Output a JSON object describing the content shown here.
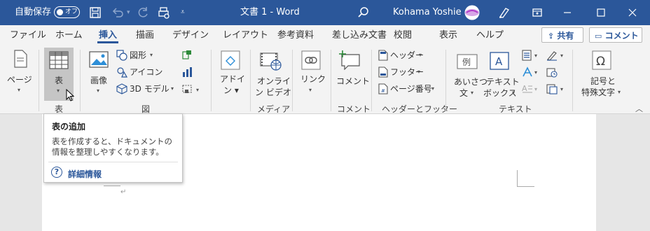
{
  "titlebar": {
    "autosave_label": "自動保存",
    "autosave_state": "オフ",
    "doc_title": "文書 1  -  Word",
    "user_name": "Kohama Yoshie"
  },
  "tabs": [
    "ファイル",
    "ホーム",
    "挿入",
    "描画",
    "デザイン",
    "レイアウト",
    "参考資料",
    "差し込み文書",
    "校閲",
    "表示",
    "ヘルプ"
  ],
  "top_buttons": {
    "share": "共有",
    "comment": "コメント"
  },
  "ribbon": {
    "page": "ページ",
    "table": "表",
    "picture": "画像",
    "shapes": "図形",
    "icons": "アイコン",
    "models3d": "3D モデル",
    "addins": "アドイ\nン",
    "online_video_1": "オンライ",
    "online_video_2": "ン ビデオ",
    "link": "リンク",
    "comment": "コメント",
    "header": "ヘッダー",
    "footer": "フッター",
    "page_number": "ページ番号",
    "greeting_1": "あいさつ",
    "greeting_2": "文",
    "textbox_1": "テキスト",
    "textbox_2": "ボックス",
    "symbol_1": "記号と",
    "symbol_2": "特殊文字",
    "groups": {
      "table": "表",
      "illustrations": "図",
      "media": "メディア",
      "comments": "コメント",
      "header_footer": "ヘッダーとフッター",
      "text": "テキスト"
    }
  },
  "tooltip": {
    "title": "表の追加",
    "description": "表を作成すると、ドキュメントの情報を整理しやすくなります。",
    "link": "詳細情報"
  },
  "colors": {
    "accent": "#2b579a",
    "ribbon_bg": "#f3f3f3",
    "doc_bg": "#e6e6e6"
  }
}
